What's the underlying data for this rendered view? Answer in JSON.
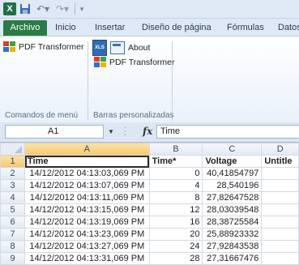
{
  "qat": {
    "excel_logo": "X"
  },
  "tabs": [
    "Archivo",
    "Inicio",
    "Insertar",
    "Diseño de página",
    "Fórmulas",
    "Datos"
  ],
  "ribbon": {
    "pdf_transformer_label": "PDF Transformer",
    "about_label": "About",
    "pdf_transformer_label2": "PDF Transformer",
    "xls_icon_text": "XLS",
    "group1_label": "Comandos de menú",
    "group2_label": "Barras personalizadas"
  },
  "formula_bar": {
    "name_box": "A1",
    "fx": "fx",
    "content": "Time"
  },
  "sheet": {
    "columns": [
      "A",
      "B",
      "C",
      "D"
    ],
    "rows": [
      {
        "n": "1",
        "cells": [
          "Time",
          "Time*",
          "Voltage",
          "Untitle"
        ]
      },
      {
        "n": "2",
        "cells": [
          "14/12/2012 04:13:03,069 PM",
          "0",
          "40,41854797",
          ""
        ]
      },
      {
        "n": "3",
        "cells": [
          "14/12/2012 04:13:07,069 PM",
          "4",
          "28,540196",
          ""
        ]
      },
      {
        "n": "4",
        "cells": [
          "14/12/2012 04:13:11,069 PM",
          "8",
          "27,82647528",
          ""
        ]
      },
      {
        "n": "5",
        "cells": [
          "14/12/2012 04:13:15,069 PM",
          "12",
          "28,03039548",
          ""
        ]
      },
      {
        "n": "6",
        "cells": [
          "14/12/2012 04:13:19,069 PM",
          "16",
          "28,38725584",
          ""
        ]
      },
      {
        "n": "7",
        "cells": [
          "14/12/2012 04:13:23,069 PM",
          "20",
          "25,88923332",
          ""
        ]
      },
      {
        "n": "8",
        "cells": [
          "14/12/2012 04:13:27,069 PM",
          "24",
          "27,92843538",
          ""
        ]
      },
      {
        "n": "9",
        "cells": [
          "14/12/2012 04:13:31,069 PM",
          "28",
          "27,31667476",
          ""
        ]
      }
    ]
  }
}
